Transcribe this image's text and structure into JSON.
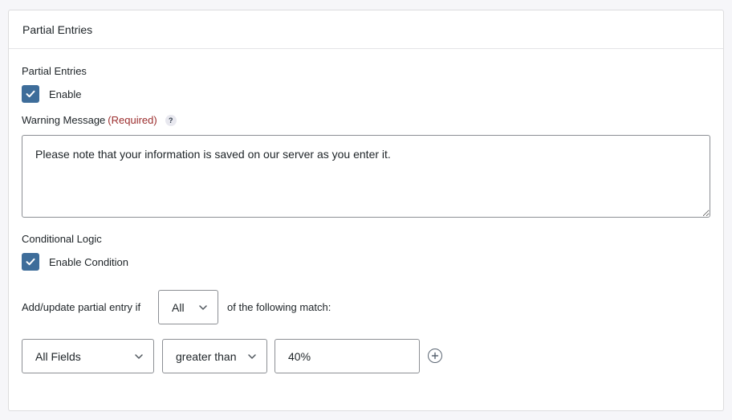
{
  "panel": {
    "title": "Partial Entries"
  },
  "partial_entries": {
    "label": "Partial Entries",
    "enable_label": "Enable",
    "enabled": true
  },
  "warning_message": {
    "label": "Warning Message",
    "required": "(Required)",
    "help": "?",
    "value": "Please note that your information is saved on our server as you enter it."
  },
  "conditional_logic": {
    "label": "Conditional Logic",
    "enable_label": "Enable Condition",
    "enabled": true,
    "prefix": "Add/update partial entry if",
    "match_select": "All",
    "suffix": "of the following match:",
    "rule": {
      "field": "All Fields",
      "operator": "greater than",
      "value": "40%"
    }
  }
}
